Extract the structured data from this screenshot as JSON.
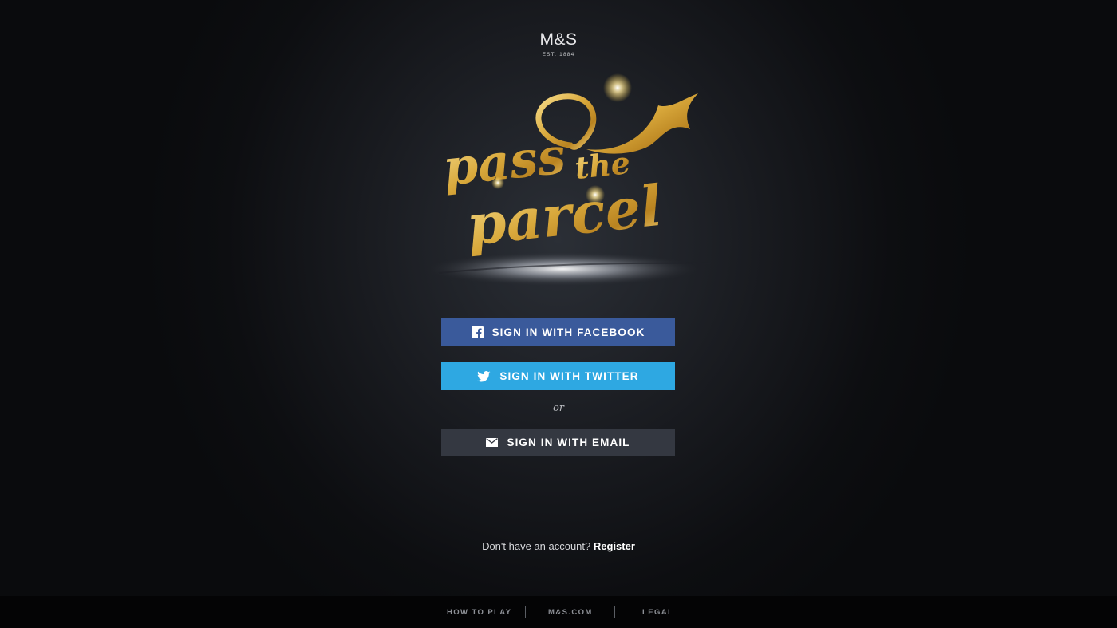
{
  "brand": {
    "name": "M&S",
    "established": "EST. 1884"
  },
  "logo": {
    "line1": "pass",
    "line2": "the",
    "line3": "parcel",
    "color": "#d9a93c"
  },
  "auth": {
    "facebook_label": "SIGN IN WITH FACEBOOK",
    "twitter_label": "SIGN IN WITH TWITTER",
    "divider_text": "or",
    "email_label": "SIGN IN WITH EMAIL"
  },
  "register": {
    "prompt": "Don't have an account?",
    "link": "Register"
  },
  "footer": {
    "items": [
      "HOW TO PLAY",
      "M&S.COM",
      "LEGAL"
    ]
  },
  "colors": {
    "facebook": "#3a5a9b",
    "twitter": "#2ea8e2",
    "email": "#343841",
    "gold": "#d9a93c"
  },
  "icons": {
    "facebook": "facebook-icon",
    "twitter": "twitter-icon",
    "email": "envelope-icon"
  }
}
